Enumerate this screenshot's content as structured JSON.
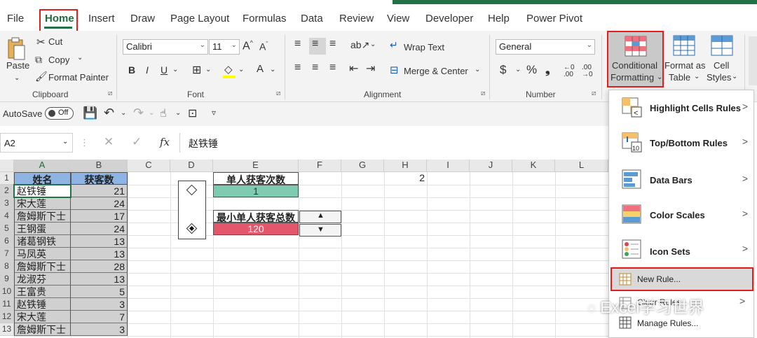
{
  "menu": {
    "items": [
      "File",
      "Home",
      "Insert",
      "Draw",
      "Page Layout",
      "Formulas",
      "Data",
      "Review",
      "View",
      "Developer",
      "Help",
      "Power Pivot"
    ]
  },
  "ribbon": {
    "clipboard": {
      "paste": "Paste",
      "cut": "Cut",
      "copy": "Copy",
      "format_painter": "Format Painter",
      "label": "Clipboard"
    },
    "font": {
      "name": "Calibri",
      "size": "11",
      "label": "Font"
    },
    "alignment": {
      "wrap": "Wrap Text",
      "merge": "Merge & Center",
      "label": "Alignment"
    },
    "number": {
      "format": "General",
      "label": "Number"
    },
    "styles": {
      "conditional_line1": "Conditional",
      "conditional_line2": "Formatting",
      "format_as_line1": "Format as",
      "format_as_line2": "Table",
      "cell_line1": "Cell",
      "cell_line2": "Styles"
    }
  },
  "qat": {
    "autosave": "AutoSave",
    "toggle": "Off"
  },
  "formula_bar": {
    "name_box": "A2",
    "fx": "fx",
    "content": "赵铁锤"
  },
  "grid": {
    "columns": [
      "A",
      "B",
      "C",
      "D",
      "E",
      "F",
      "G",
      "H",
      "I",
      "J",
      "K",
      "L"
    ],
    "rows": [
      "1",
      "2",
      "3",
      "4",
      "5",
      "6",
      "7",
      "8",
      "9",
      "10",
      "11",
      "12",
      "13"
    ],
    "header_a": "姓名",
    "header_b": "获客数",
    "names": [
      "赵铁锤",
      "宋大莲",
      "詹姆斯下士",
      "王钢蛋",
      "诸葛钢铁",
      "马凤英",
      "詹姆斯下士",
      "龙淑芬",
      "王富贵",
      "赵铁锤",
      "宋大莲",
      "詹姆斯下士"
    ],
    "counts": [
      "21",
      "24",
      "17",
      "24",
      "13",
      "13",
      "28",
      "13",
      "5",
      "3",
      "7",
      "3"
    ],
    "e1": "单人获客次数",
    "e2": "1",
    "e4": "最小单人获客总数",
    "e5": "120",
    "h1": "2"
  },
  "cf_menu": {
    "highlight": "Highlight Cells Rules",
    "topbottom": "Top/Bottom Rules",
    "databars": "Data Bars",
    "colorscales": "Color Scales",
    "iconsets": "Icon Sets",
    "newrule": "New Rule...",
    "clear": "Clear Rules",
    "manage": "Manage Rules..."
  },
  "watermark": "Excel学习世界",
  "colors": {
    "excel_green": "#217346",
    "highlight_red": "#e02020",
    "header_blue": "#8db4e2",
    "teal_cell": "#7ecbb1",
    "red_cell": "#e4566a"
  }
}
